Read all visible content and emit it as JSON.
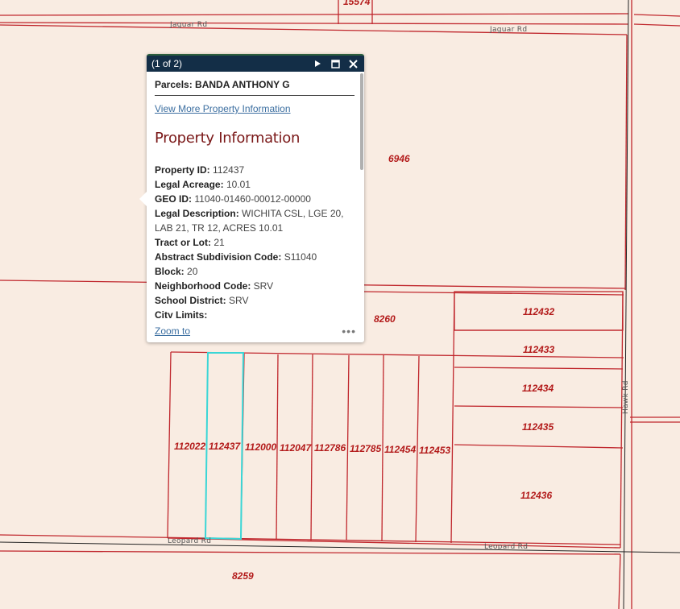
{
  "map": {
    "roads": [
      {
        "name": "Jaguar Rd"
      },
      {
        "name": "Jaguar Rd"
      },
      {
        "name": "Leopard Rd"
      },
      {
        "name": "Leopard Rd"
      },
      {
        "name": "Hawk Rd"
      }
    ],
    "parcels": [
      {
        "id": "15574"
      },
      {
        "id": "6946"
      },
      {
        "id": "8260"
      },
      {
        "id": "8259"
      },
      {
        "id": "112432"
      },
      {
        "id": "112433"
      },
      {
        "id": "112434"
      },
      {
        "id": "112435"
      },
      {
        "id": "112436"
      },
      {
        "id": "112022"
      },
      {
        "id": "112437"
      },
      {
        "id": "112000"
      },
      {
        "id": "112047"
      },
      {
        "id": "112786"
      },
      {
        "id": "112785"
      },
      {
        "id": "112454"
      },
      {
        "id": "112453"
      }
    ],
    "selected_parcel": "112437",
    "colors": {
      "parcel_line": "#c0272d",
      "selection": "#3ad6d6",
      "background": "#f9ece2"
    }
  },
  "popup": {
    "counter": "(1 of 2)",
    "icons": {
      "next": "play-icon",
      "maximize": "maximize-icon",
      "close": "close-icon"
    },
    "layer_label": "Parcels:",
    "owner": "BANDA ANTHONY G",
    "more_info_link": "View More Property Information",
    "section_title": "Property Information",
    "attributes": [
      {
        "key": "Property ID:",
        "value": "112437"
      },
      {
        "key": "Legal Acreage:",
        "value": "10.01"
      },
      {
        "key": "GEO ID:",
        "value": "11040-01460-00012-00000"
      },
      {
        "key": "Legal Description:",
        "value": "WICHITA CSL, LGE 20, LAB 21, TR 12, ACRES 10.01"
      },
      {
        "key": "Tract or Lot:",
        "value": "21"
      },
      {
        "key": "Abstract Subdivision Code:",
        "value": "S11040"
      },
      {
        "key": "Block:",
        "value": "20"
      },
      {
        "key": "Neighborhood Code:",
        "value": "SRV"
      },
      {
        "key": "School District:",
        "value": "SRV"
      },
      {
        "key": "City Limits:",
        "value": ""
      }
    ],
    "zoom_link": "Zoom to",
    "more_actions": "•••"
  }
}
